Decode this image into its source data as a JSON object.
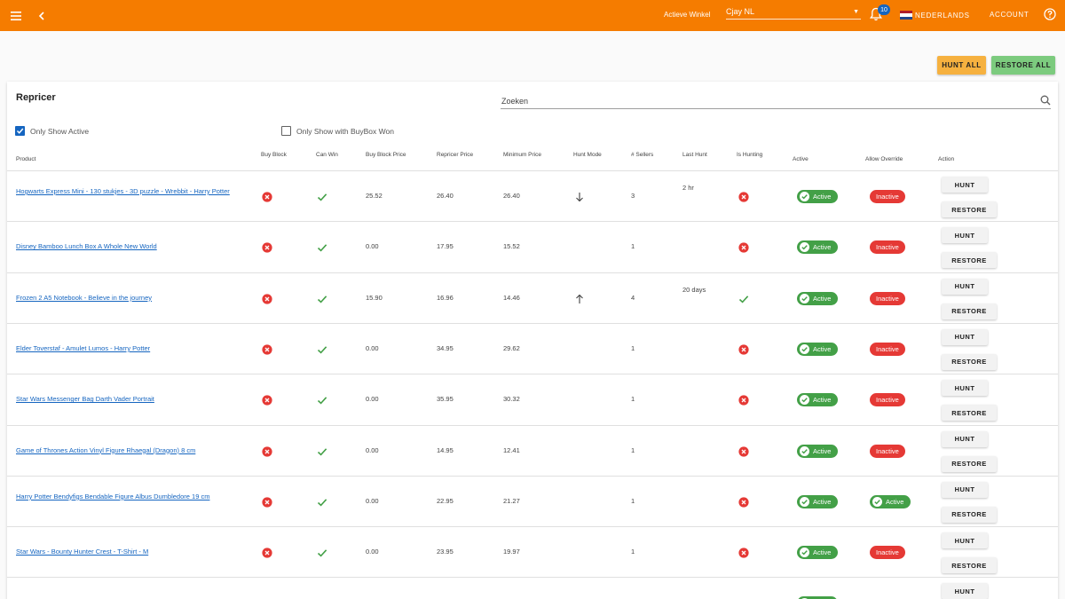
{
  "topbar": {
    "store_label": "Actieve Winkel",
    "store_value": "Cjay NL",
    "notification_count": "10",
    "language": "NEDERLANDS",
    "account": "ACCOUNT",
    "bg_color": "#f57c00"
  },
  "actions": {
    "hunt_all": "HUNT ALL",
    "restore_all": "RESTORE ALL"
  },
  "repricer": {
    "title": "Repricer",
    "search_placeholder": "Zoeken",
    "filter_active": "Only Show Active",
    "filter_active_checked": true,
    "filter_buybox": "Only Show with BuyBox Won",
    "filter_buybox_checked": false
  },
  "columns": {
    "product": "Product",
    "buy_block": "Buy Block",
    "can_win": "Can Win",
    "buy_block_price": "Buy Block Price",
    "repricer_price": "Repricer Price",
    "minimum_price": "Minimum Price",
    "hunt_mode": "Hunt Mode",
    "sellers": "# Sellers",
    "last_hunt": "Last Hunt",
    "is_hunting": "Is Hunting",
    "active": "Active",
    "allow_override": "Allow Override",
    "action": "Action"
  },
  "labels": {
    "active": "Active",
    "inactive": "Inactive",
    "hunt": "HUNT",
    "restore": "RESTORE"
  },
  "rows": [
    {
      "product": "Hogwarts Express Mini - 130 stukjes - 3D puzzle - Wrebbit - Harry Potter",
      "buy_block": false,
      "can_win": true,
      "buy_block_price": "25.52",
      "repricer_price": "26.40",
      "minimum_price": "26.40",
      "hunt_mode": "down",
      "sellers": "3",
      "last_hunt": "2 hr",
      "is_hunting": false,
      "active": true,
      "allow_override": false
    },
    {
      "product": "Disney Bamboo Lunch Box A Whole New World",
      "buy_block": false,
      "can_win": true,
      "buy_block_price": "0.00",
      "repricer_price": "17.95",
      "minimum_price": "15.52",
      "hunt_mode": "",
      "sellers": "1",
      "last_hunt": "",
      "is_hunting": false,
      "active": true,
      "allow_override": false
    },
    {
      "product": "Frozen 2 A5 Notebook - Believe in the journey",
      "buy_block": false,
      "can_win": true,
      "buy_block_price": "15.90",
      "repricer_price": "16.96",
      "minimum_price": "14.46",
      "hunt_mode": "up",
      "sellers": "4",
      "last_hunt": "20 days",
      "is_hunting": true,
      "active": true,
      "allow_override": false
    },
    {
      "product": "Elder Toverstaf - Amulet Lumos - Harry Potter",
      "buy_block": false,
      "can_win": true,
      "buy_block_price": "0.00",
      "repricer_price": "34.95",
      "minimum_price": "29.62",
      "hunt_mode": "",
      "sellers": "1",
      "last_hunt": "",
      "is_hunting": false,
      "active": true,
      "allow_override": false
    },
    {
      "product": "Star Wars Messenger Bag Darth Vader Portrait",
      "buy_block": false,
      "can_win": true,
      "buy_block_price": "0.00",
      "repricer_price": "35.95",
      "minimum_price": "30.32",
      "hunt_mode": "",
      "sellers": "1",
      "last_hunt": "",
      "is_hunting": false,
      "active": true,
      "allow_override": false
    },
    {
      "product": "Game of Thrones Action Vinyl Figure Rhaegal (Dragon) 8 cm",
      "buy_block": false,
      "can_win": true,
      "buy_block_price": "0.00",
      "repricer_price": "14.95",
      "minimum_price": "12.41",
      "hunt_mode": "",
      "sellers": "1",
      "last_hunt": "",
      "is_hunting": false,
      "active": true,
      "allow_override": false
    },
    {
      "product": "Harry Potter Bendyfigs Bendable Figure Albus Dumbledore 19 cm",
      "buy_block": false,
      "can_win": true,
      "buy_block_price": "0.00",
      "repricer_price": "22.95",
      "minimum_price": "21.27",
      "hunt_mode": "",
      "sellers": "1",
      "last_hunt": "",
      "is_hunting": false,
      "active": true,
      "allow_override": true
    },
    {
      "product": "Star Wars - Bounty Hunter Crest - T-Shirt - M",
      "buy_block": false,
      "can_win": true,
      "buy_block_price": "0.00",
      "repricer_price": "23.95",
      "minimum_price": "19.97",
      "hunt_mode": "",
      "sellers": "1",
      "last_hunt": "",
      "is_hunting": false,
      "active": true,
      "allow_override": false
    },
    {
      "product": "",
      "buy_block": null,
      "can_win": null,
      "buy_block_price": "",
      "repricer_price": "",
      "minimum_price": "",
      "hunt_mode": "",
      "sellers": "",
      "last_hunt": "",
      "is_hunting": null,
      "active": true,
      "allow_override": null
    }
  ]
}
